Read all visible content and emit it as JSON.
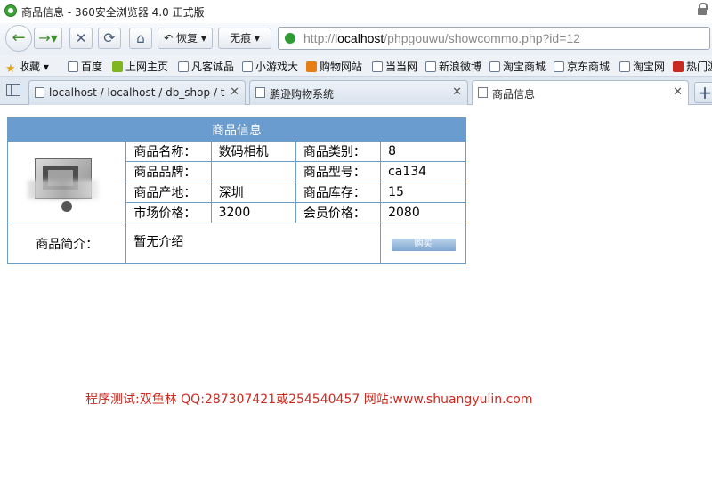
{
  "window": {
    "title": "商品信息 - 360安全浏览器 4.0 正式版"
  },
  "toolbar": {
    "back_icon": "←",
    "forward_icon": "→▾",
    "stop_icon": "✕",
    "reload_icon": "⟳",
    "home_icon": "⌂",
    "restore_label": "↶ 恢复 ▾",
    "noreach_label": "无痕 ▾"
  },
  "address": {
    "prefix": "http://",
    "host": "localhost",
    "path": "/phpgouwu/showcommo.php?id=12"
  },
  "bookmarks": [
    {
      "label": "收藏 ▾",
      "icon": "star-icon"
    },
    {
      "label": "百度",
      "icon": "page-icon"
    },
    {
      "label": "上网主页",
      "icon": "hao-icon"
    },
    {
      "label": "凡客诚品",
      "icon": "page-icon"
    },
    {
      "label": "小游戏大",
      "icon": "page-icon"
    },
    {
      "label": "购物网站",
      "icon": "shopping-icon"
    },
    {
      "label": "当当网",
      "icon": "page-icon"
    },
    {
      "label": "新浪微博",
      "icon": "page-icon"
    },
    {
      "label": "淘宝商城",
      "icon": "page-icon"
    },
    {
      "label": "京东商城",
      "icon": "page-icon"
    },
    {
      "label": "淘宝网",
      "icon": "page-icon"
    },
    {
      "label": "热门游",
      "icon": "hot-icon"
    }
  ],
  "tabs": [
    {
      "label": "localhost / localhost / db_shop / t...",
      "active": false
    },
    {
      "label": "鹏逊购物系统",
      "active": false
    },
    {
      "label": "商品信息",
      "active": true
    }
  ],
  "product": {
    "header": "商品信息",
    "name_label": "商品名称：",
    "name_value": "数码相机",
    "category_label": "商品类别：",
    "category_value": "8",
    "brand_label": "商品品牌：",
    "brand_value": "",
    "model_label": "商品型号：",
    "model_value": "ca134",
    "origin_label": "商品产地：",
    "origin_value": "深圳",
    "stock_label": "商品库存：",
    "stock_value": "15",
    "market_label": "市场价格：",
    "market_value": "3200",
    "member_label": "会员价格：",
    "member_value": "2080",
    "intro_label": "商品简介：",
    "intro_value": "暂无介绍",
    "buy_label": "购买"
  },
  "footer": {
    "note": "程序测试:双鱼林 QQ:287307421或254540457 网站:www.shuangyulin.com"
  },
  "colors": {
    "table_header": "#6a9cd0",
    "table_border": "#6d9dc5",
    "footer_text": "#cc2a1f"
  }
}
